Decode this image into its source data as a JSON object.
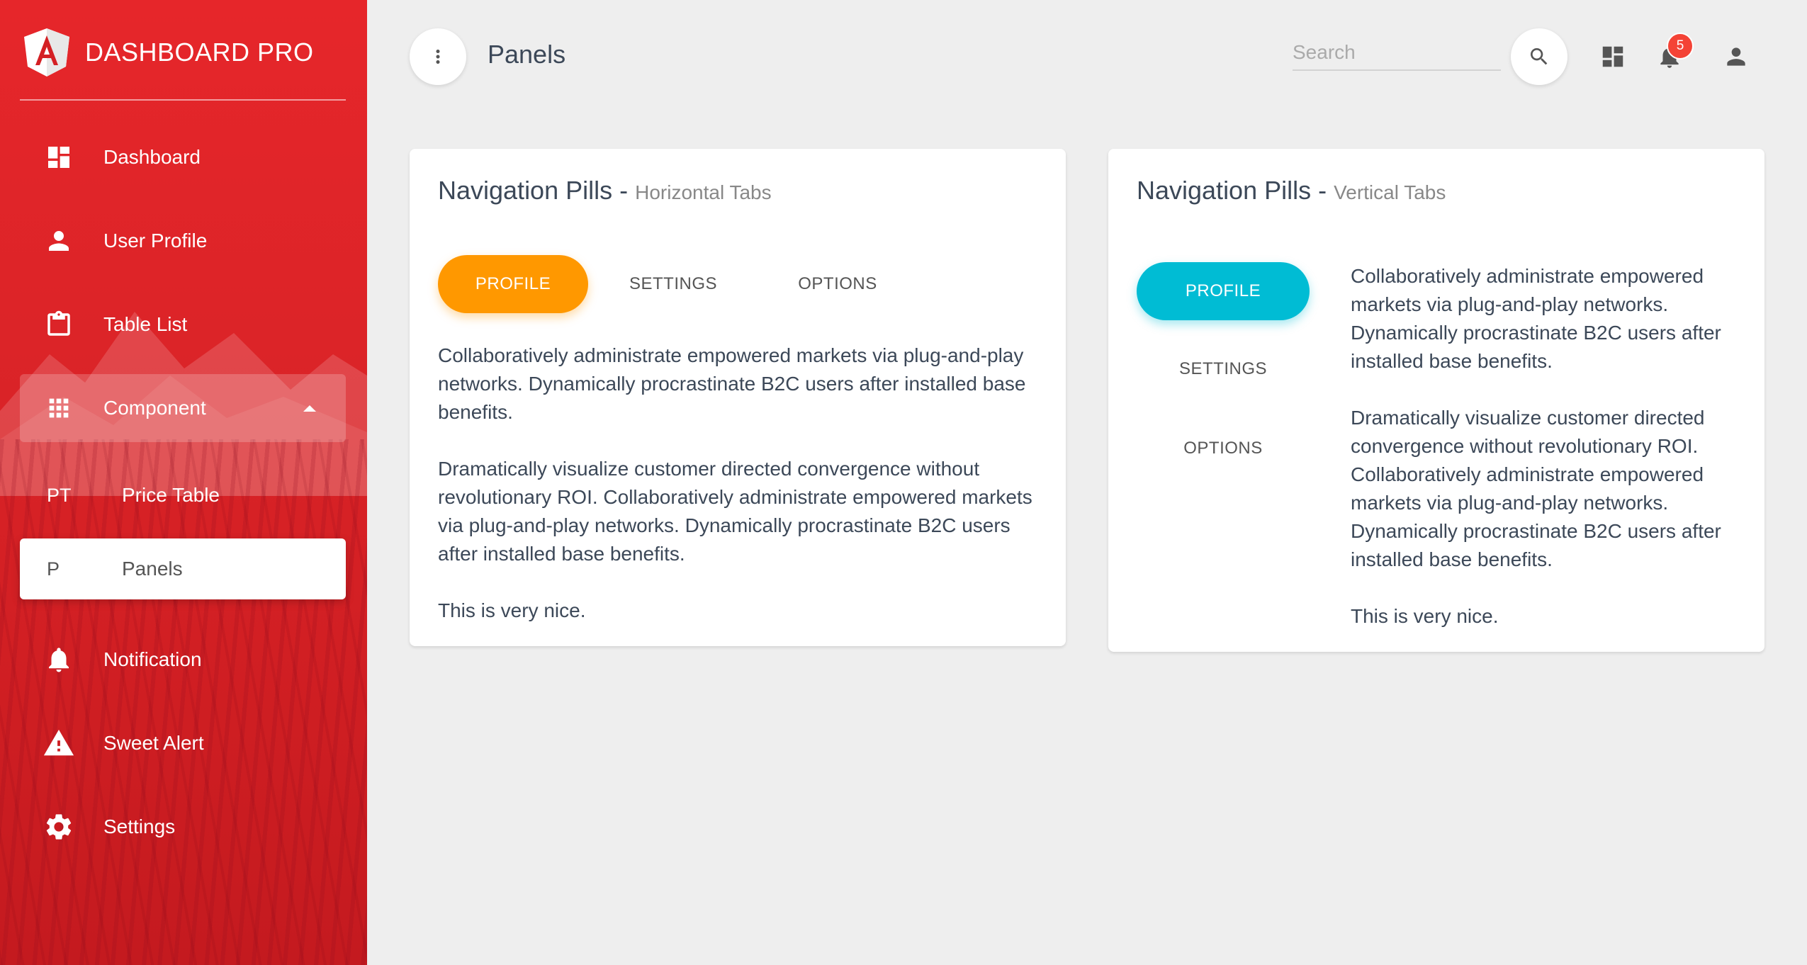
{
  "brand": {
    "name": "DASHBOARD PRO"
  },
  "sidebar": {
    "items": [
      {
        "label": "Dashboard",
        "icon": "dashboard-icon"
      },
      {
        "label": "User Profile",
        "icon": "person-icon"
      },
      {
        "label": "Table List",
        "icon": "clipboard-icon"
      },
      {
        "label": "Component",
        "icon": "apps-grid-icon",
        "expanded": true
      },
      {
        "label": "Notification",
        "icon": "bell-icon"
      },
      {
        "label": "Sweet Alert",
        "icon": "warning-icon"
      },
      {
        "label": "Settings",
        "icon": "gear-icon"
      }
    ],
    "subitems": [
      {
        "abbr": "PT",
        "label": "Price Table"
      },
      {
        "abbr": "P",
        "label": "Panels",
        "active": true
      }
    ]
  },
  "header": {
    "title": "Panels",
    "search_placeholder": "Search",
    "notification_count": "5"
  },
  "cards": [
    {
      "title": "Navigation Pills",
      "separator": " - ",
      "subtitle": "Horizontal Tabs",
      "tabs": [
        "PROFILE",
        "SETTINGS",
        "OPTIONS"
      ],
      "active_tab": "PROFILE",
      "accent": "#ff9800",
      "paragraphs": [
        "Collaboratively administrate empowered markets via plug-and-play networks. Dynamically procrastinate B2C users after installed base benefits.",
        "Dramatically visualize customer directed convergence without revolutionary ROI. Collaboratively administrate empowered markets via plug-and-play networks. Dynamically procrastinate B2C users after installed base benefits.",
        "This is very nice."
      ]
    },
    {
      "title": "Navigation Pills",
      "separator": " - ",
      "subtitle": "Vertical Tabs",
      "tabs": [
        "PROFILE",
        "SETTINGS",
        "OPTIONS"
      ],
      "active_tab": "PROFILE",
      "accent": "#00bcd4",
      "paragraphs": [
        "Collaboratively administrate empowered markets via plug-and-play networks. Dynamically procrastinate B2C users after installed base benefits.",
        "Dramatically visualize customer directed convergence without revolutionary ROI. Collaboratively administrate empowered markets via plug-and-play networks. Dynamically procrastinate B2C users after installed base benefits.",
        "This is very nice."
      ]
    }
  ],
  "colors": {
    "sidebar": "#e6262a",
    "background": "#eeeeee",
    "badge": "#f44336"
  }
}
